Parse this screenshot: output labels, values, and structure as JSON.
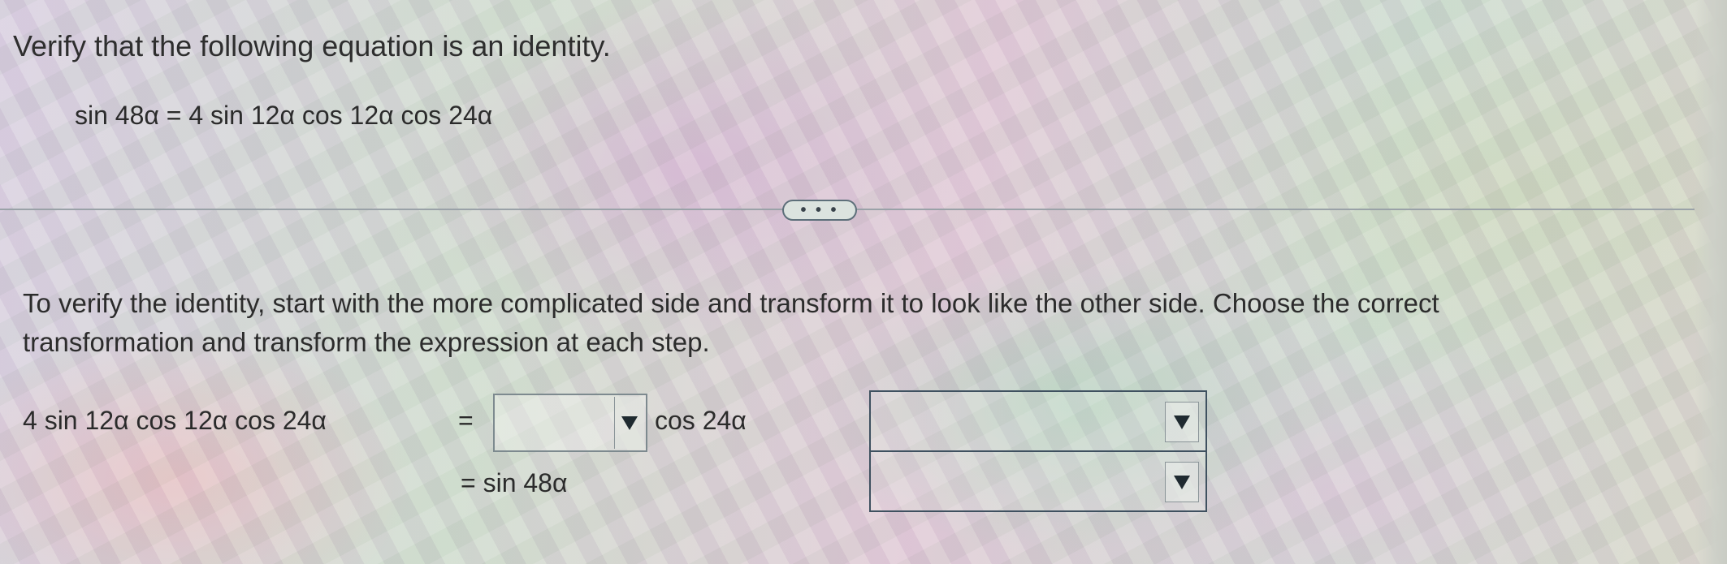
{
  "problem": {
    "title": "Verify that the following equation is an identity.",
    "equation": "sin 48α = 4 sin 12α cos 12α cos 24α"
  },
  "divider": {
    "expand_label": "• • •"
  },
  "instructions": "To verify the identity, start with the more complicated side and transform it to look like the other side. Choose the correct transformation and transform the expression at each step.",
  "work": {
    "left_expression": "4 sin 12α cos 12α cos 24α",
    "equals": "=",
    "step1_dropdown_value": "",
    "step1_suffix": "cos 24α",
    "step2": "= sin 48α",
    "reason1_value": "",
    "reason2_value": ""
  },
  "icons": {
    "dropdown": "triangle-down-icon"
  }
}
